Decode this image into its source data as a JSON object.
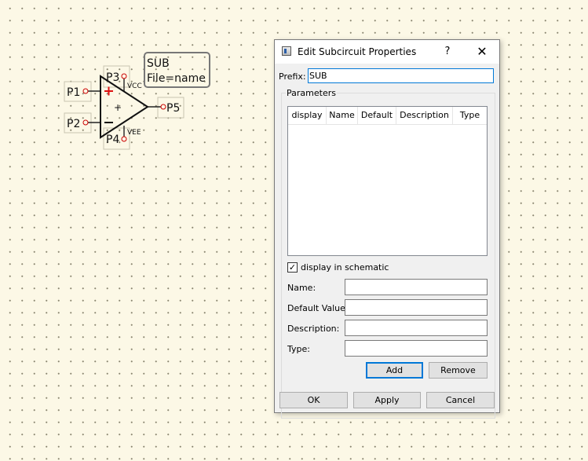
{
  "schematic": {
    "pins": {
      "p1": "P1",
      "p2": "P2",
      "p3": "P3",
      "p4": "P4",
      "p5": "P5"
    },
    "vcc_label": "VCC",
    "vee_label": "VEE",
    "opamp_center_mark": "+",
    "sub_box": {
      "line1": "SUB",
      "line2": "File=name"
    }
  },
  "dialog": {
    "title": "Edit Subcircuit Properties",
    "help_label": "?",
    "close_label": "✕",
    "prefix_label": "Prefix:",
    "prefix_value": "SUB",
    "parameters_label": "Parameters",
    "table": {
      "columns": [
        "display",
        "Name",
        "Default",
        "Description",
        "Type"
      ],
      "rows": []
    },
    "display_checkbox": {
      "label": "display in schematic",
      "checked": true
    },
    "fields": {
      "name_label": "Name:",
      "default_value_label": "Default Value:",
      "description_label": "Description:",
      "type_label": "Type:",
      "name_value": "",
      "default_value_value": "",
      "description_value": "",
      "type_value": ""
    },
    "buttons": {
      "add": "Add",
      "remove": "Remove",
      "ok": "OK",
      "apply": "Apply",
      "cancel": "Cancel"
    }
  }
}
